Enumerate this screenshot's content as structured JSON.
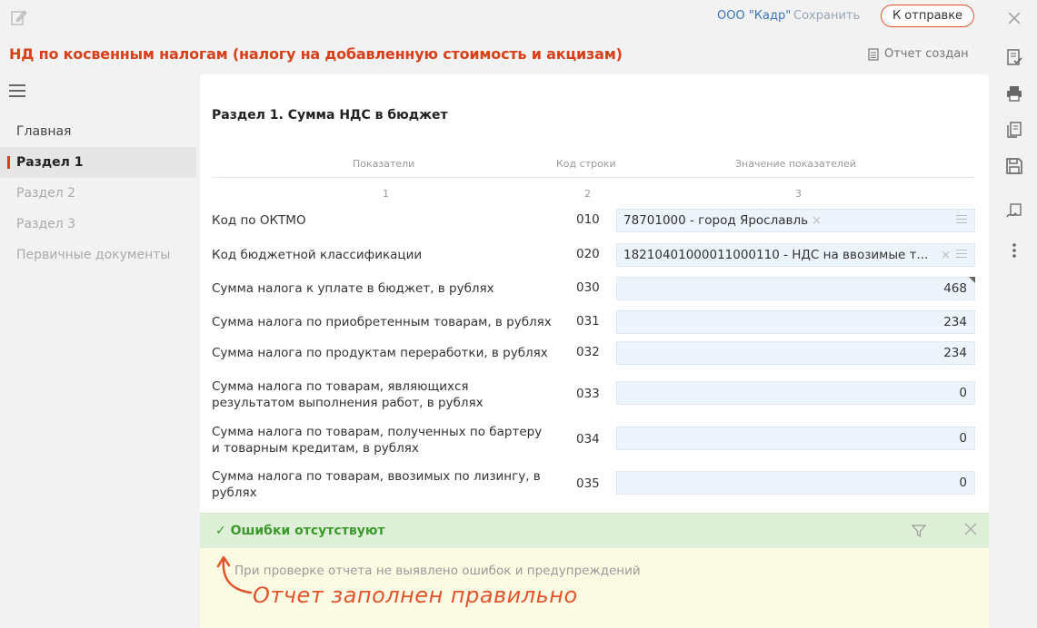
{
  "header": {
    "org_name": "ООО \"Кадр\"",
    "save_label": "Сохранить",
    "send_label": "К отправке",
    "title": "НД по косвенным налогам (налогу на добавленную стоимость и акцизам)",
    "status": "Отчет создан"
  },
  "sidebar": {
    "items": [
      {
        "label": "Главная"
      },
      {
        "label": "Раздел 1"
      },
      {
        "label": "Раздел 2"
      },
      {
        "label": "Раздел 3"
      },
      {
        "label": "Первичные документы"
      }
    ],
    "active": "Раздел 1"
  },
  "section": {
    "title": "Раздел 1. Сумма НДС в бюджет",
    "columns": [
      "Показатели",
      "Код строки",
      "Значение показателей"
    ],
    "column_numbers": [
      "1",
      "2",
      "3"
    ],
    "rows": [
      {
        "label": "Код по ОКТМО",
        "code": "010",
        "value": "78701000 - город Ярославль",
        "type": "select"
      },
      {
        "label": "Код бюджетной классификации",
        "code": "020",
        "value": "18210401000011000110 - НДС на ввозимые т...",
        "type": "select"
      },
      {
        "label": "Сумма налога к уплате в бюджет, в рублях",
        "code": "030",
        "value": "468",
        "type": "number"
      },
      {
        "label": "Сумма налога по приобретенным товарам, в рублях",
        "code": "031",
        "value": "234",
        "type": "number"
      },
      {
        "label": "Сумма налога по продуктам переработки, в рублях",
        "code": "032",
        "value": "234",
        "type": "number"
      },
      {
        "label": "Сумма налога по товарам, являющихся результатом выполнения работ, в рублях",
        "code": "033",
        "value": "0",
        "type": "number"
      },
      {
        "label": "Сумма налога по товарам, полученных по бартеру и товарным кредитам, в рублях",
        "code": "034",
        "value": "0",
        "type": "number"
      },
      {
        "label": "Сумма налога по товарам, ввозимых по лизингу, в рублях",
        "code": "035",
        "value": "0",
        "type": "number"
      }
    ]
  },
  "check": {
    "title": "✓ Ошибки отсутствуют",
    "message": "При проверке отчета не выявлено ошибок и предупреждений",
    "annotation": "Отчет заполнен правильно"
  },
  "colors": {
    "accent": "#d7401a",
    "link": "#3b74bf",
    "success": "#3c9a2d",
    "field_bg": "#eef4fb"
  }
}
